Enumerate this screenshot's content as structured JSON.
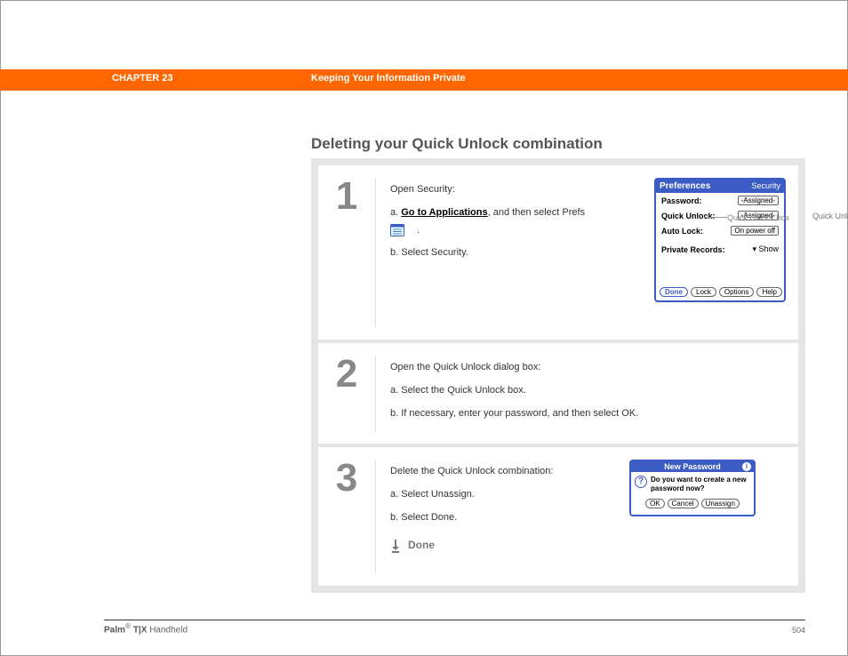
{
  "header": {
    "chapter": "CHAPTER 23",
    "title": "Keeping Your Information Private"
  },
  "section_title": "Deleting your Quick Unlock combination",
  "steps": [
    {
      "num": "1",
      "intro": "Open Security:",
      "a_letter": "a.",
      "a_link": "Go to Applications",
      "a_rest": ", and then select Prefs ",
      "a_tail": ".",
      "b": "b.  Select Security."
    },
    {
      "num": "2",
      "intro": "Open the Quick Unlock dialog box:",
      "a": "a.  Select the Quick Unlock box.",
      "b": "b.  If necessary, enter your password, and then select OK."
    },
    {
      "num": "3",
      "intro": "Delete the Quick Unlock combination:",
      "a": "a.  Select Unassign.",
      "b": "b.  Select Done.",
      "done": "Done"
    }
  ],
  "palm1": {
    "title_left": "Preferences",
    "title_right": "Security",
    "rows": {
      "password_label": "Password:",
      "password_val": "-Assigned-",
      "quick_label": "Quick Unlock:",
      "quick_val": "-Assigned-",
      "auto_label": "Auto Lock:",
      "auto_val": "On power off",
      "priv_label": "Private Records:",
      "priv_val": "▾ Show"
    },
    "buttons": {
      "done": "Done",
      "lock": "Lock",
      "options": "Options",
      "help": "Help"
    },
    "callout": "Quick Unlock box"
  },
  "palm2": {
    "title": "New Password",
    "text": "Do you want to create a new password now?",
    "buttons": {
      "ok": "OK",
      "cancel": "Cancel",
      "unassign": "Unassign"
    }
  },
  "footer": {
    "brand_bold": "Palm",
    "brand_reg": "®",
    "brand_model": " T|X ",
    "brand_tail": "Handheld",
    "page": "504"
  }
}
